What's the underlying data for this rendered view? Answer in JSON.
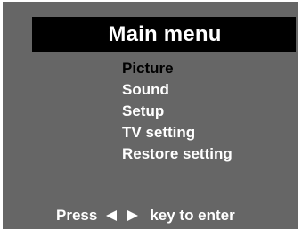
{
  "menu": {
    "title": "Main menu",
    "items": [
      {
        "label": "Picture",
        "selected": true
      },
      {
        "label": "Sound",
        "selected": false
      },
      {
        "label": "Setup",
        "selected": false
      },
      {
        "label": "TV setting",
        "selected": false
      },
      {
        "label": "Restore setting",
        "selected": false
      }
    ]
  },
  "hint": {
    "prefix": "Press",
    "left_icon": "left-arrow-icon",
    "right_icon": "right-arrow-icon",
    "suffix": "key to enter"
  },
  "colors": {
    "background": "#666666",
    "title_bar": "#000000",
    "text": "#ffffff",
    "selected_text": "#000000"
  }
}
